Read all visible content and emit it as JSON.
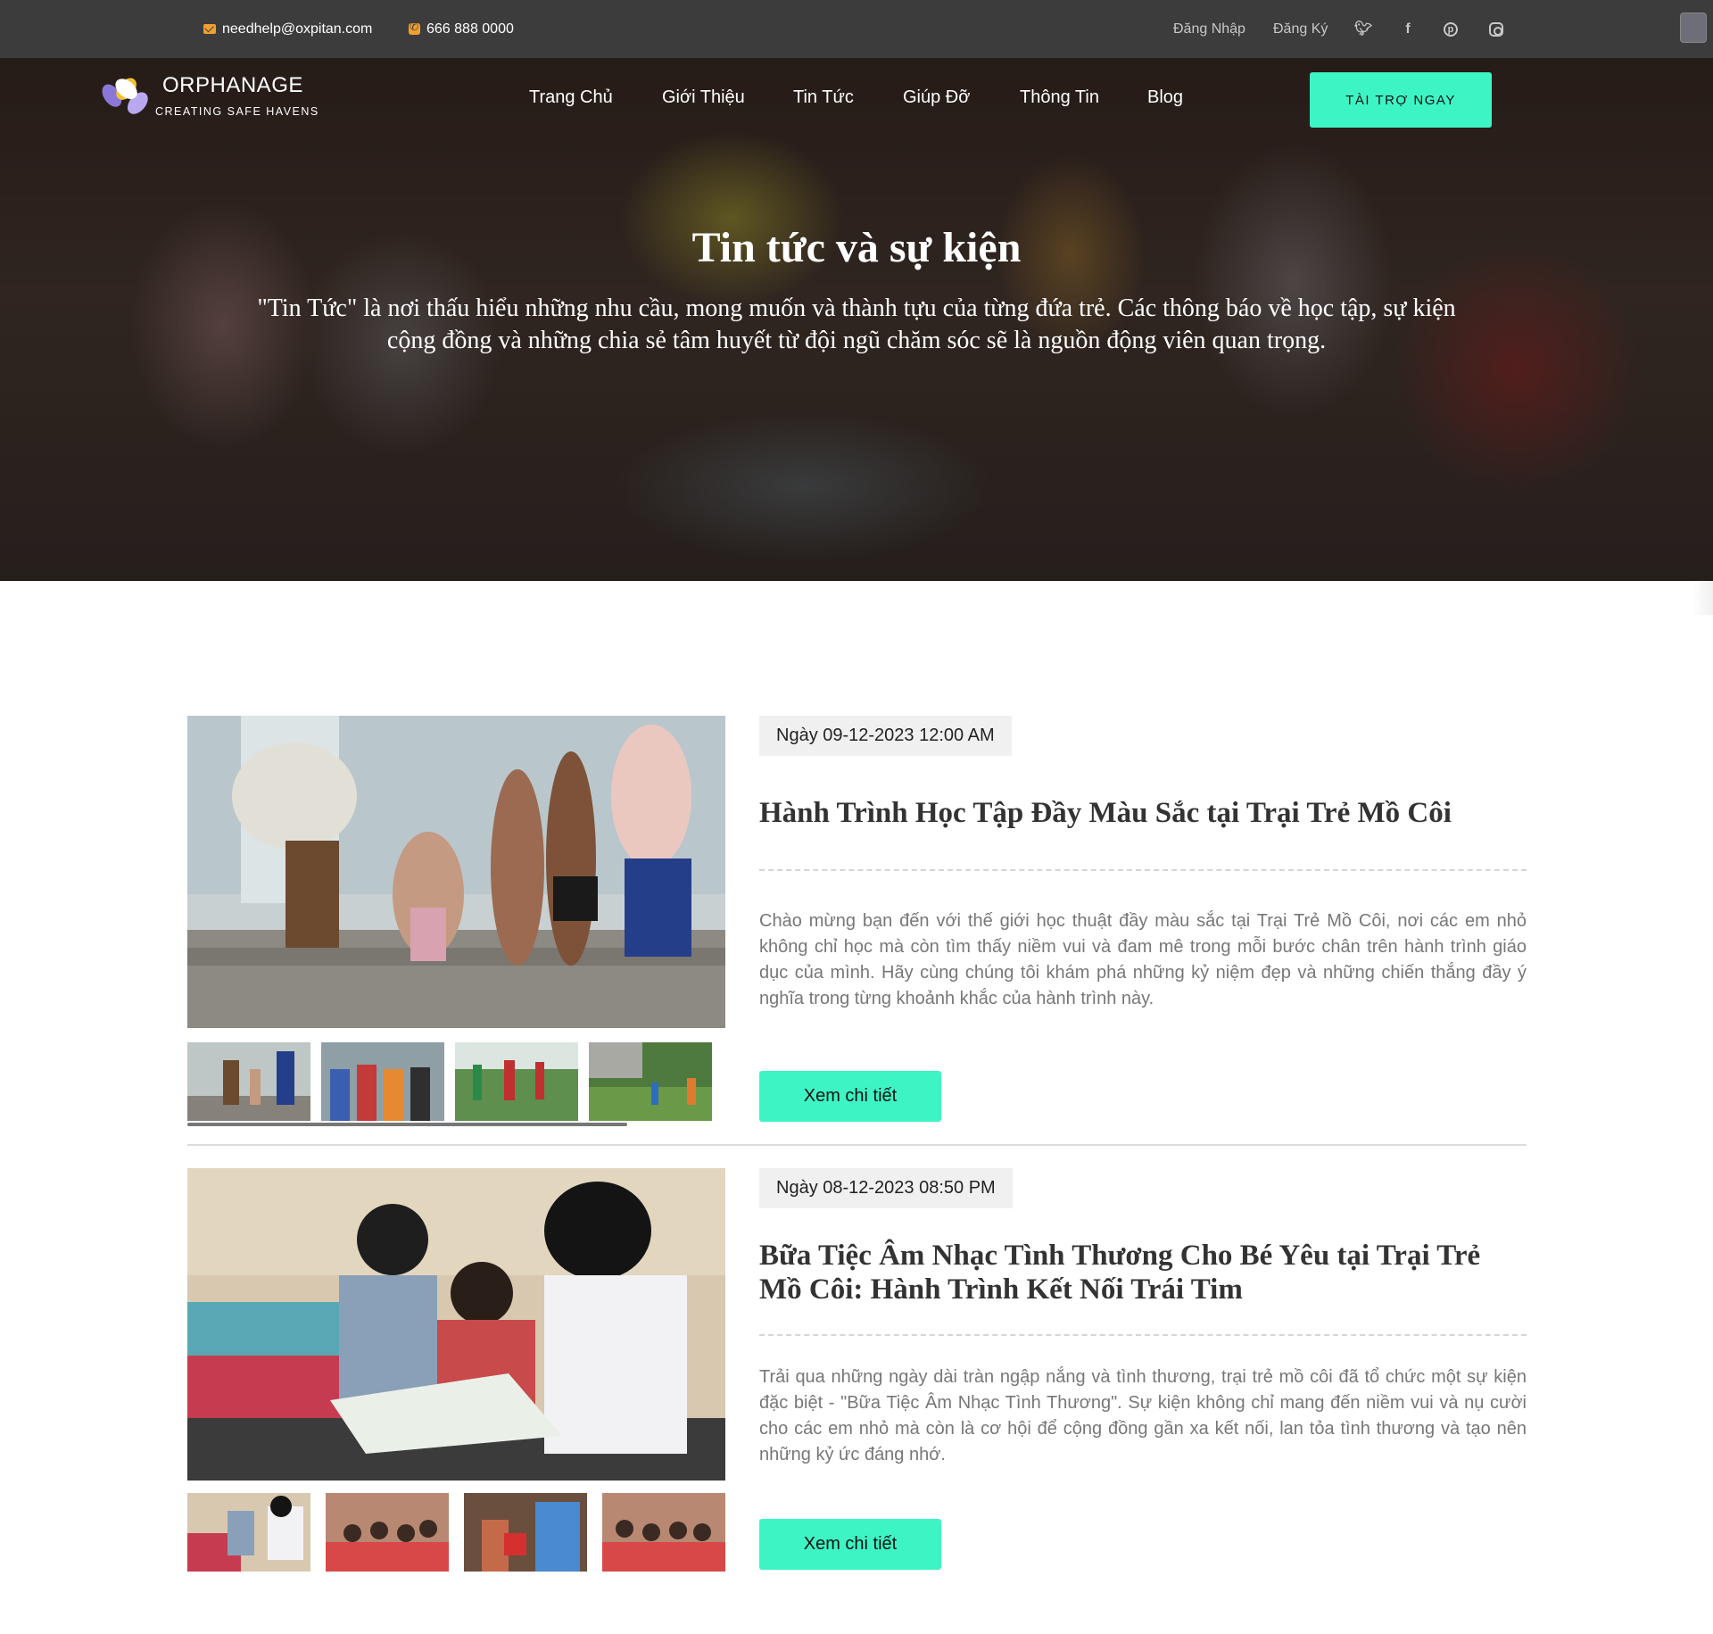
{
  "topbar": {
    "email": "needhelp@oxpitan.com",
    "phone": "666 888 0000",
    "login": "Đăng Nhập",
    "register": "Đăng Ký",
    "social": {
      "twitter": "twitter-icon",
      "facebook": "facebook-icon",
      "pinterest": "pinterest-icon",
      "instagram": "instagram-icon"
    }
  },
  "brand": {
    "name": "ORPHANAGE",
    "tagline": "CREATING SAFE HAVENS",
    "colors": {
      "accent": "#3df5c4",
      "topbar": "#3c3c3c",
      "icon": "#f0a030"
    }
  },
  "nav": {
    "items": [
      "Trang Chủ",
      "Giới Thiệu",
      "Tin Tức",
      "Giúp Đỡ",
      "Thông Tin",
      "Blog"
    ],
    "cta": "TÀI TRỢ NGAY"
  },
  "hero": {
    "title": "Tin tức và sự kiện",
    "subtitle": "\"Tin Tức\" là nơi thấu hiểu những nhu cầu, mong muốn và thành tựu của từng đứa trẻ. Các thông báo về học tập, sự kiện cộng đồng và những chia sẻ tâm huyết từ đội ngũ chăm sóc sẽ là nguồn động viên quan trọng."
  },
  "articles": [
    {
      "date": "Ngày 09-12-2023 12:00 AM",
      "title": "Hành Trình Học Tập Đầy Màu Sắc tại Trại Trẻ Mồ Côi",
      "excerpt": "Chào mừng bạn đến với thế giới học thuật đầy màu sắc tại Trại Trẻ Mồ Côi, nơi các em nhỏ không chỉ học mà còn tìm thấy niềm vui và đam mê trong mỗi bước chân trên hành trình giáo dục của mình. Hãy cùng chúng tôi khám phá những kỷ niệm đẹp và những chiến thắng đầy ý nghĩa trong từng khoảnh khắc của hành trình này.",
      "button": "Xem chi tiết"
    },
    {
      "date": "Ngày 08-12-2023 08:50 PM",
      "title": "Bữa Tiệc Âm Nhạc Tình Thương Cho Bé Yêu tại Trại Trẻ Mồ Côi: Hành Trình Kết Nối Trái Tim",
      "excerpt": "Trải qua những ngày dài tràn ngập nắng và tình thương, trại trẻ mồ côi đã tổ chức một sự kiện đặc biệt - \"Bữa Tiệc Âm Nhạc Tình Thương\". Sự kiện không chỉ mang đến niềm vui và nụ cười cho các em nhỏ mà còn là cơ hội để cộng đồng gần xa kết nối, lan tỏa tình thương và tạo nên những kỷ ức đáng nhớ.",
      "button": "Xem chi tiết"
    }
  ]
}
